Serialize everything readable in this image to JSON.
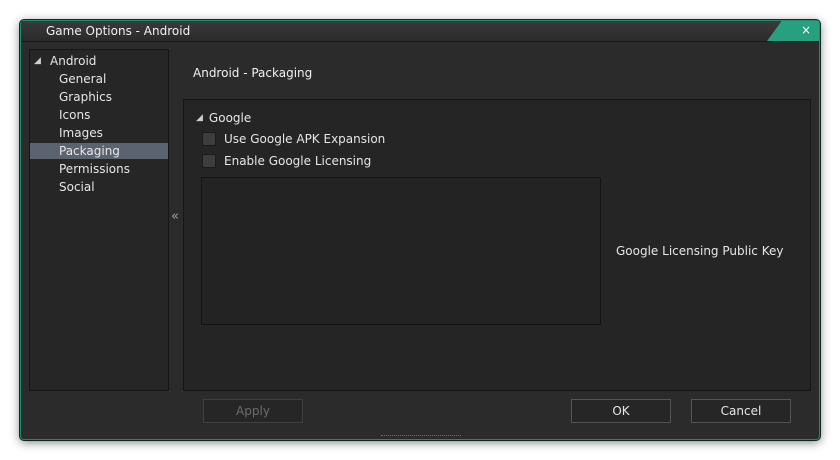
{
  "window": {
    "title": "Game Options - Android",
    "close_label": "×"
  },
  "tree": {
    "root": {
      "label": "Android",
      "expander": "◢"
    },
    "items": [
      {
        "label": "General"
      },
      {
        "label": "Graphics"
      },
      {
        "label": "Icons"
      },
      {
        "label": "Images"
      },
      {
        "label": "Packaging",
        "selected": true
      },
      {
        "label": "Permissions"
      },
      {
        "label": "Social"
      }
    ],
    "collapse_label": "«"
  },
  "page": {
    "title": "Android - Packaging",
    "group": {
      "label": "Google",
      "expander": "◢",
      "options": [
        {
          "label": "Use Google APK Expansion",
          "checked": false
        },
        {
          "label": "Enable Google Licensing",
          "checked": false
        }
      ],
      "public_key": {
        "label": "Google Licensing Public Key",
        "value": ""
      }
    }
  },
  "buttons": {
    "apply": "Apply",
    "ok": "OK",
    "cancel": "Cancel"
  },
  "colors": {
    "accent": "#26a07e",
    "selected": "#5c6370",
    "background": "#2b2b2b"
  }
}
